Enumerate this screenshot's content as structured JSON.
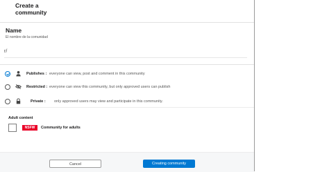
{
  "dialog": {
    "title_line1": "Create a",
    "title_line2": "community"
  },
  "name_section": {
    "label": "Name",
    "hint": "El nombre de la comunidad",
    "prefix": "r/",
    "value": ""
  },
  "options": [
    {
      "title": "Publishes :",
      "description": "everyone can view, post and comment in this community",
      "icon": "person-icon",
      "selected": true
    },
    {
      "title": "Restricted :",
      "description": "everyone can view this community, but only approved users can publish",
      "icon": "eye-off-icon",
      "selected": false
    },
    {
      "title": "Private :",
      "description": "only approved users may view and participate in this community.",
      "icon": "lock-icon",
      "selected": false
    }
  ],
  "adult": {
    "label": "Adult content",
    "badge": "NSFW",
    "text": "Community for adults",
    "checked": false
  },
  "footer": {
    "cancel_label": "Cancel",
    "create_label": "Creating community"
  },
  "colors": {
    "accent": "#0079d3",
    "nsfw": "#ea0027"
  }
}
